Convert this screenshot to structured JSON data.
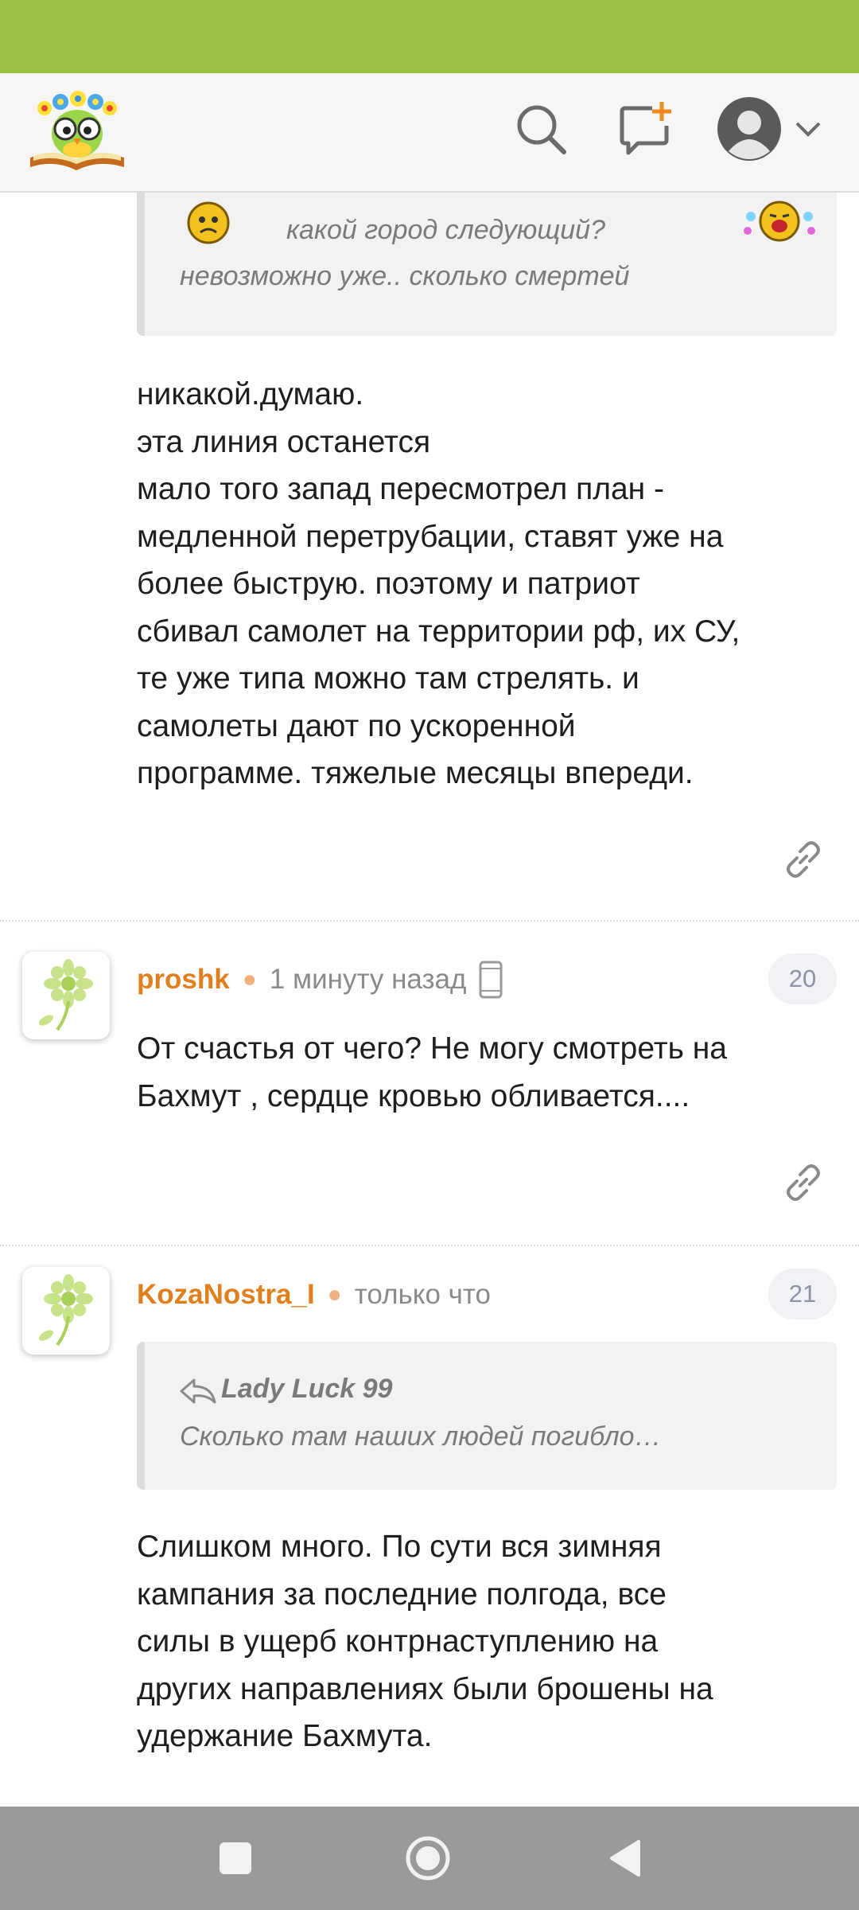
{
  "app": {
    "icons": {
      "logo": "owl-book-logo",
      "search": "search-icon",
      "new_post": "new-message-icon",
      "profile": "user-avatar-icon",
      "menu": "chevron-down-icon"
    },
    "colors": {
      "status_bar": "#9dc144",
      "author": "#e07f1c",
      "nav_bar": "#9a9a9a"
    }
  },
  "posts": [
    {
      "quote": {
        "lines": [
          "какой    город    следующий?",
          "невозможно уже.. сколько смертей"
        ]
      },
      "text_lines": [
        "никакой.думаю.",
        "эта линия останется",
        "мало того запад пересмотрел план -",
        "медленной перетрубации, ставят уже на",
        "более быструю. поэтому и патриот",
        "сбивал самолет на территории рф, их СУ,",
        "те уже типа можно там стрелять. и",
        "самолеты дают по ускоренной",
        "программе. тяжелые месяцы впереди."
      ]
    },
    {
      "author": "proshk",
      "time": "1 минуту назад",
      "number": "20",
      "device": "mobile-phone-icon",
      "text_lines": [
        "От счастья от чего? Не могу смотреть на",
        "Бахмут , сердце кровью обливается...."
      ]
    },
    {
      "author": "KozaNostra_I",
      "time": "только что",
      "number": "21",
      "quote": {
        "author": "Lady Luck 99",
        "text": "Сколько там наших людей погибло…"
      },
      "text_lines": [
        "Слишком много. По сути вся зимняя",
        "кампания за последние полгода, все",
        "силы в ущерб контрнаступлению на",
        "других направлениях были брошены на",
        "удержание Бахмута."
      ]
    }
  ],
  "nav": {
    "icons": [
      "recent-apps-icon",
      "home-icon",
      "back-icon"
    ]
  }
}
